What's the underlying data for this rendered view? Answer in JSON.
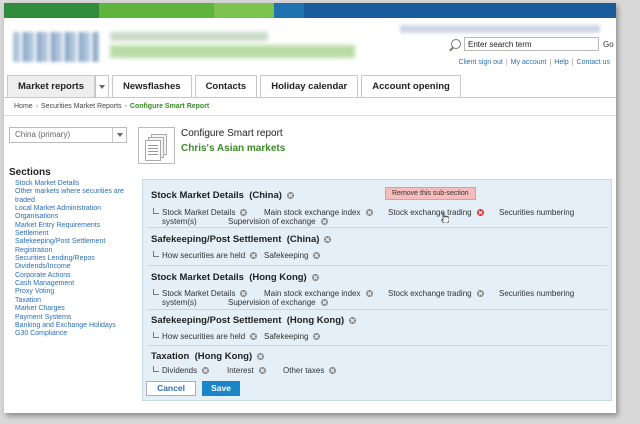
{
  "brand_colors": [
    "#2e8c3b",
    "#5fb43e",
    "#7cc24f",
    "#1f74b0",
    "#1a5b9c"
  ],
  "search": {
    "placeholder": "Enter search term",
    "go_label": "Go"
  },
  "toplinks": [
    "Client sign out",
    "My account",
    "Help",
    "Contact us"
  ],
  "tabs": [
    {
      "label": "Market reports",
      "active": true,
      "has_dropdown": true
    },
    {
      "label": "Newsflashes"
    },
    {
      "label": "Contacts"
    },
    {
      "label": "Holiday calendar"
    },
    {
      "label": "Account opening"
    }
  ],
  "breadcrumb": [
    "Home",
    "Securities Market Reports",
    "Configure Smart Report"
  ],
  "market_select": {
    "value": "China (primary)"
  },
  "sidebar": {
    "title": "Sections",
    "items": [
      "Stock Market Details",
      "Other markets where securities are",
      "traded",
      "Local Market Administration",
      "Organisations",
      "Market Entry Requirements",
      "Settlement",
      "Safekeeping/Post Settlement",
      "Registration",
      "Securities Lending/Repos",
      "Dividends/Income",
      "Corporate Actions",
      "Cash Management",
      "Proxy Voting",
      "Taxation",
      "Market Charges",
      "Payment Systems",
      "Banking and Exchange Holidays",
      "G30 Compliance"
    ]
  },
  "report": {
    "title": "Configure Smart report",
    "name": "Chris's Asian markets"
  },
  "tooltip": "Remove this sub-section",
  "sections": [
    {
      "title": "Stock Market Details",
      "market": "(China)",
      "items": [
        "Stock Market Details",
        "Main stock exchange index",
        "Stock exchange trading",
        "Securities numbering",
        "system(s)",
        "Supervision of exchange"
      ]
    },
    {
      "title": "Safekeeping/Post Settlement",
      "market": "(China)",
      "items": [
        "How securities are held",
        "Safekeeping"
      ]
    },
    {
      "title": "Stock Market Details",
      "market": "(Hong Kong)",
      "items": [
        "Stock Market Details",
        "Main stock exchange index",
        "Stock exchange trading",
        "Securities numbering",
        "system(s)",
        "Supervision of exchange"
      ]
    },
    {
      "title": "Safekeeping/Post Settlement",
      "market": "(Hong Kong)",
      "items": [
        "How securities are held",
        "Safekeeping"
      ]
    },
    {
      "title": "Taxation",
      "market": "(Hong Kong)",
      "items": [
        "Dividends",
        "Interest",
        "Other taxes"
      ]
    }
  ],
  "buttons": {
    "cancel": "Cancel",
    "save": "Save"
  }
}
